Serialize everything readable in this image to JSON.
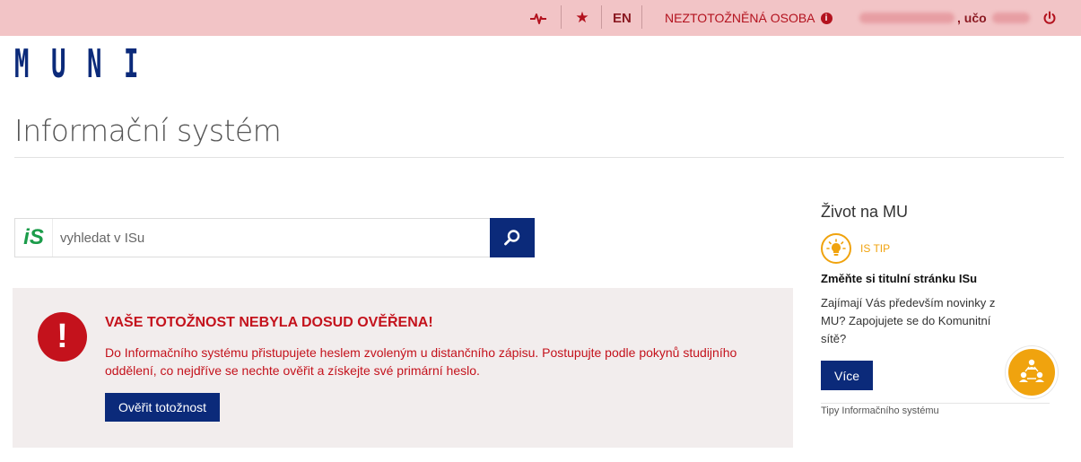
{
  "topbar": {
    "lang": "EN",
    "status_label": "NEZTOTOŽNĚNÁ OSOBA",
    "status_info_glyph": "i",
    "uco_label": ", učo",
    "icons": {
      "pulse": "pulse-icon",
      "favorites": "star-icon",
      "info": "info-icon",
      "logout": "power-icon"
    },
    "color": "#b3121e",
    "background": "#f2c4c6"
  },
  "logo": {
    "letters": [
      "M",
      "U",
      "N",
      "I"
    ],
    "color": "#0b2a7a"
  },
  "page_title": "Informační systém",
  "search": {
    "badge_i": "i",
    "badge_s": "S",
    "placeholder": "vyhledat v ISu",
    "value": "",
    "button_icon": "search-icon"
  },
  "alert": {
    "icon_glyph": "!",
    "heading": "VAŠE TOTOŽNOST NEBYLA DOSUD OVĚŘENA!",
    "text": "Do Informačního systému přistupujete heslem zvoleným u distančního zápisu. Postupujte podle pokynů studijního oddělení, co nejdříve se nechte ověřit a získejte své primární heslo.",
    "button_label": "Ověřit totožnost",
    "color": "#c4121c"
  },
  "sidebar": {
    "heading": "Život na MU",
    "tip_label": "IS TIP",
    "tip_title": "Změňte si titulní stránku ISu",
    "tip_text": "Zajímají Vás především novinky z MU? Zapojujete se do Komunitní sítě?",
    "more_button": "Více",
    "footer": "Tipy Informačního systému",
    "accent": "#f0a30e"
  },
  "colors": {
    "brand_blue": "#0b2a7a"
  }
}
